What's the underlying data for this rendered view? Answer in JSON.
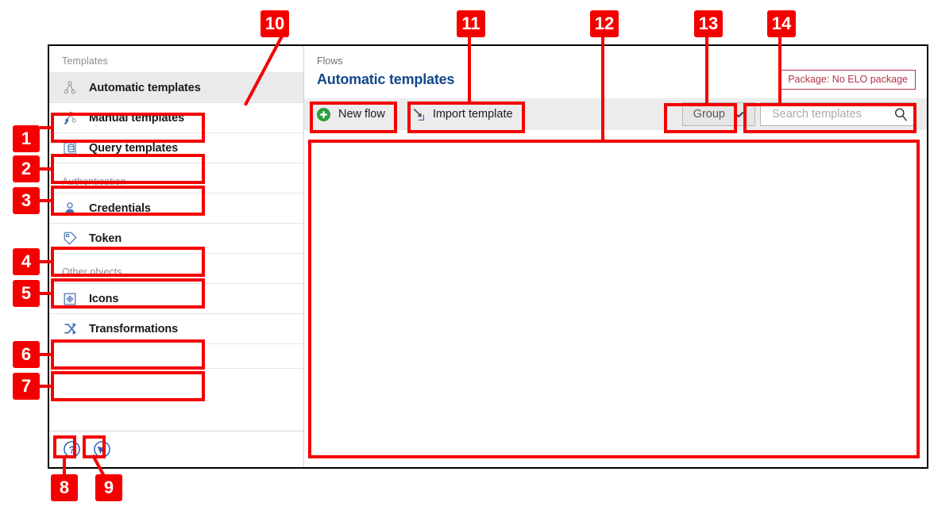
{
  "window": {
    "breadcrumb": "Flows",
    "page_title": "Automatic templates",
    "package_badge": "Package: No ELO package"
  },
  "sidebar": {
    "sections": [
      {
        "header": "Templates",
        "items": [
          {
            "label": "Automatic templates",
            "icon": "flow-tree-icon",
            "selected": true
          },
          {
            "label": "Manual templates",
            "icon": "manual-flow-tree-icon",
            "selected": false
          },
          {
            "label": "Query templates",
            "icon": "database-query-icon",
            "selected": false
          }
        ]
      },
      {
        "header": "Authentication",
        "items": [
          {
            "label": "Credentials",
            "icon": "user-icon",
            "selected": false
          },
          {
            "label": "Token",
            "icon": "tag-icon",
            "selected": false
          }
        ]
      },
      {
        "header": "Other objects",
        "items": [
          {
            "label": "Icons",
            "icon": "image-diamond-icon",
            "selected": false
          },
          {
            "label": "Transformations",
            "icon": "shuffle-arrows-icon",
            "selected": false
          }
        ]
      }
    ],
    "footer": [
      {
        "icon": "help-circle-icon",
        "name": "help-button"
      },
      {
        "icon": "feedback-pointer-icon",
        "name": "feedback-button"
      }
    ]
  },
  "toolbar": {
    "new_flow_label": "New flow",
    "import_template_label": "Import template",
    "group_label": "Group",
    "search_placeholder": "Search templates",
    "search_value": ""
  },
  "colors": {
    "accent_blue": "#13498b",
    "annotation_red": "#f40000",
    "badge_red": "#b0354a",
    "toolbar_grey": "#ececec",
    "selected_grey": "#e9eaeb",
    "add_green": "#2e9e3e"
  },
  "annotations": {
    "callouts": [
      {
        "number": "1",
        "target": "sidebar-item-automatic-templates"
      },
      {
        "number": "2",
        "target": "sidebar-item-manual-templates"
      },
      {
        "number": "3",
        "target": "sidebar-item-query-templates"
      },
      {
        "number": "4",
        "target": "sidebar-item-credentials"
      },
      {
        "number": "5",
        "target": "sidebar-item-token"
      },
      {
        "number": "6",
        "target": "sidebar-item-icons"
      },
      {
        "number": "7",
        "target": "sidebar-item-transformations"
      },
      {
        "number": "8",
        "target": "help-button"
      },
      {
        "number": "9",
        "target": "feedback-button"
      },
      {
        "number": "10",
        "target": "new-flow-button"
      },
      {
        "number": "11",
        "target": "import-template-button"
      },
      {
        "number": "12",
        "target": "content-area"
      },
      {
        "number": "13",
        "target": "group-button"
      },
      {
        "number": "14",
        "target": "search-box"
      }
    ]
  }
}
